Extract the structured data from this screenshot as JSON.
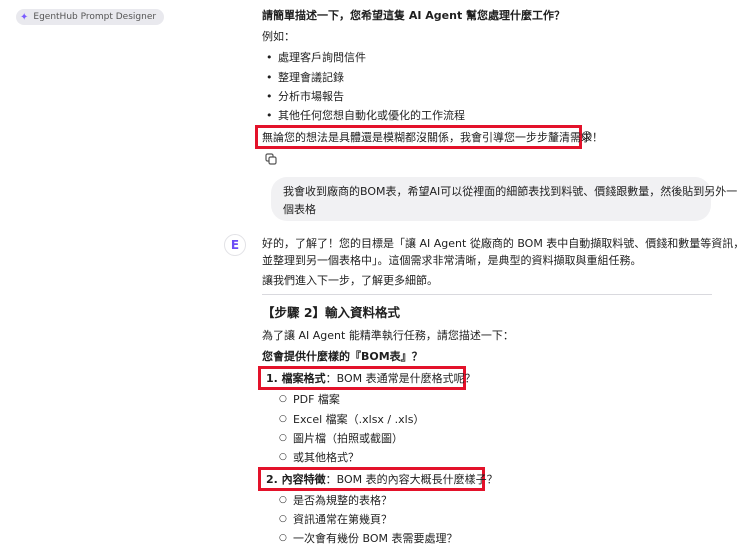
{
  "app": {
    "title": "EgentHub Prompt Designer"
  },
  "assistant_top": {
    "question": "請簡單描述一下，您希望這隻 AI Agent 幫您處理什麼工作？",
    "example_label": "例如：",
    "examples": [
      "處理客戶詢問信件",
      "整理會議記錄",
      "分析市場報告",
      "其他任何您想自動化或優化的工作流程"
    ],
    "reassure": "無論您的想法是具體還是模糊都沒關係，我會引導您一步步釐清需求！",
    "reassure_emoji": "😊"
  },
  "user_message": {
    "line1": "我會收到廠商的BOM表，希望AI可以從裡面的細節表找到料號、價錢跟數量，然後貼到另外一",
    "line2": "個表格"
  },
  "assistant_reply": {
    "avatar_letter": "E",
    "p1_line1": "好的，了解了！您的目標是「讓 AI Agent 從廠商的 BOM 表中自動擷取料號、價錢和數量等資訊，",
    "p1_line2": "並整理到另一個表格中」。這個需求非常清晰，是典型的資料擷取與重組任務。",
    "p2": "讓我們進入下一步，了解更多細節。",
    "step_heading": "【步驟 2】輸入資料格式",
    "intro": "為了讓 AI Agent 能精準執行任務，請您描述一下：",
    "question": "您會提供什麼樣的『BOM表』？",
    "q1_label": "1. 檔案格式",
    "q1_text": "：BOM 表通常是什麼格式呢？",
    "q1_options": [
      "PDF 檔案",
      "Excel 檔案（.xlsx / .xls）",
      "圖片檔（拍照或截圖）",
      "或其他格式？"
    ],
    "q2_label": "2. 內容特徵",
    "q2_text": "：BOM 表的內容大概長什麼樣子？",
    "q2_options": [
      "是否為規整的表格？",
      "資訊通常在第幾頁？",
      "一次會有幾份 BOM 表需要處理？"
    ]
  },
  "icons": {
    "app_icon": "sparkle-wand-icon",
    "copy": "copy-icon",
    "avatar": "egenthub-logo"
  },
  "colors": {
    "highlight": "#e3122a",
    "accent": "#6b4cf6",
    "bubble": "#f1f1f3"
  }
}
